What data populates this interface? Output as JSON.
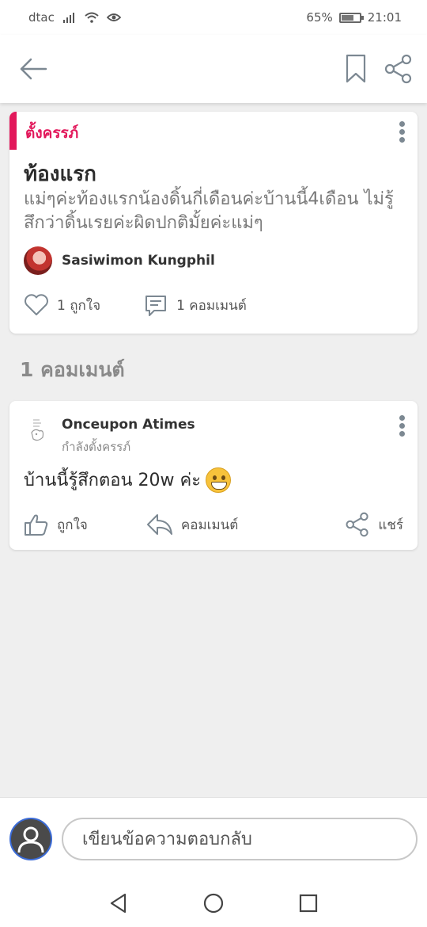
{
  "status_bar": {
    "carrier": "dtac",
    "battery": "65%",
    "time": "21:01"
  },
  "topbar": {
    "back_icon": "arrow-left-icon",
    "bookmark_icon": "bookmark-icon",
    "share_icon": "share-icon"
  },
  "post": {
    "tag": "ตั้งครรภ์",
    "title": "ท้องแรก",
    "body": "แม่ๆค่ะท้องแรกน้องดิ้นกี่เดือนค่ะบ้านนี้4เดือน ไม่รู้สึกว่าดิ้นเรยค่ะผิดปกติมั้ยค่ะแม่ๆ",
    "author": "Sasiwimon Kungphil",
    "likes": "1 ถูกใจ",
    "comments": "1 คอมเมนต์",
    "accent_color": "#e2185b"
  },
  "comments_section": {
    "title": "1 คอมเมนต์"
  },
  "comment": {
    "author": "Onceupon Atimes",
    "subtitle": "กำลังตั้งครรภ์",
    "text": "บ้านนี้รู้สึกตอน 20w ค่ะ",
    "emoji": "grinning-face-icon",
    "like_label": "ถูกใจ",
    "reply_label": "คอมเมนต์",
    "share_label": "แชร์"
  },
  "reply_bar": {
    "placeholder": "เขียนข้อความตอบกลับ"
  }
}
